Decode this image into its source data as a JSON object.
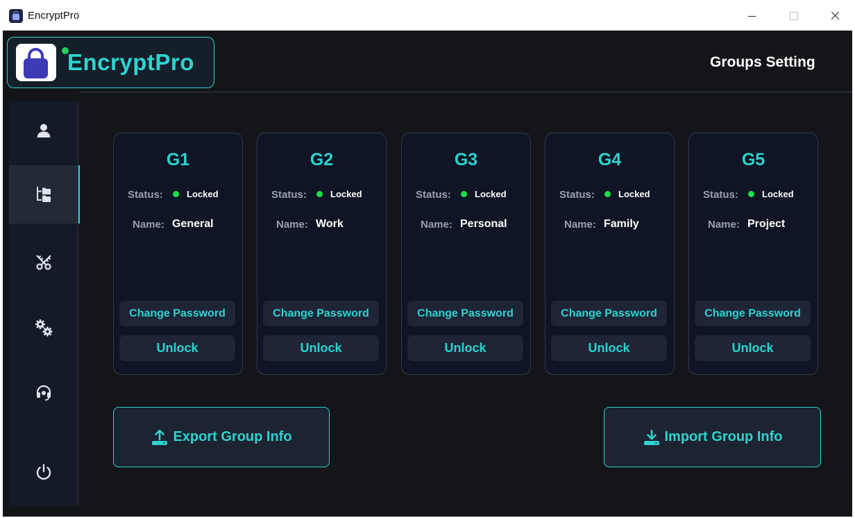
{
  "window": {
    "title": "EncryptPro"
  },
  "header": {
    "logo_text": "EncryptPro",
    "page_title": "Groups Setting"
  },
  "sidebar": {
    "items": [
      {
        "icon": "user-icon",
        "active": false
      },
      {
        "icon": "groups-icon",
        "active": true
      },
      {
        "icon": "keys-icon",
        "active": false
      },
      {
        "icon": "gears-icon",
        "active": false
      },
      {
        "icon": "headset-icon",
        "active": false
      },
      {
        "icon": "power-icon",
        "active": false
      }
    ]
  },
  "groups": [
    {
      "id": "G1",
      "status_label": "Status:",
      "status": "Locked",
      "name_label": "Name:",
      "name": "General",
      "change_label": "Change Password",
      "unlock_label": "Unlock"
    },
    {
      "id": "G2",
      "status_label": "Status:",
      "status": "Locked",
      "name_label": "Name:",
      "name": "Work",
      "change_label": "Change Password",
      "unlock_label": "Unlock"
    },
    {
      "id": "G3",
      "status_label": "Status:",
      "status": "Locked",
      "name_label": "Name:",
      "name": "Personal",
      "change_label": "Change Password",
      "unlock_label": "Unlock"
    },
    {
      "id": "G4",
      "status_label": "Status:",
      "status": "Locked",
      "name_label": "Name:",
      "name": "Family",
      "change_label": "Change Password",
      "unlock_label": "Unlock"
    },
    {
      "id": "G5",
      "status_label": "Status:",
      "status": "Locked",
      "name_label": "Name:",
      "name": "Project",
      "change_label": "Change Password",
      "unlock_label": "Unlock"
    }
  ],
  "actions": {
    "export_label": "Export Group Info",
    "import_label": "Import Group Info"
  },
  "colors": {
    "accent": "#2ed3cf",
    "status_ok": "#19e043",
    "background": "#141518",
    "card": "#0f1524"
  }
}
